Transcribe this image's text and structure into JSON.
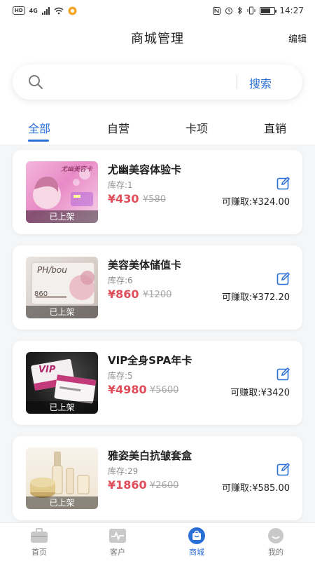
{
  "status_bar": {
    "left_badges": [
      "HD",
      "4G"
    ],
    "time": "14:27"
  },
  "header": {
    "title": "商城管理",
    "edit_label": "编辑"
  },
  "search": {
    "placeholder": "",
    "button_label": "搜索"
  },
  "tabs": [
    {
      "label": "全部",
      "active": true
    },
    {
      "label": "自营",
      "active": false
    },
    {
      "label": "卡项",
      "active": false
    },
    {
      "label": "直销",
      "active": false
    }
  ],
  "products": [
    {
      "title": "尤幽美容体验卡",
      "stock": "库存:1",
      "price": "¥430",
      "original_price": "¥580",
      "earnings": "可赚取:¥324.00",
      "status": "已上架",
      "thumb_text": "尤幽美容卡",
      "thumb_icon": "beauty-card-pink"
    },
    {
      "title": "美容美体储值卡",
      "stock": "库存:6",
      "price": "¥860",
      "original_price": "¥1200",
      "earnings": "可赚取:¥372.20",
      "status": "已上架",
      "thumb_text": "PH/bou",
      "thumb_text2": "860",
      "thumb_icon": "membership-card"
    },
    {
      "title": "VIP全身SPA年卡",
      "stock": "库存:5",
      "price": "¥4980",
      "original_price": "¥5600",
      "earnings": "可赚取:¥3420",
      "status": "已上架",
      "thumb_text": "VIP",
      "thumb_icon": "vip-card"
    },
    {
      "title": "雅姿美白抗皱套盒",
      "stock": "库存:29",
      "price": "¥1860",
      "original_price": "¥2600",
      "earnings": "可赚取:¥585.00",
      "status": "已上架",
      "thumb_icon": "cosmetics-set"
    }
  ],
  "bottom_nav": [
    {
      "label": "首页",
      "icon": "home-briefcase-icon",
      "active": false
    },
    {
      "label": "客户",
      "icon": "customer-pulse-icon",
      "active": false
    },
    {
      "label": "商城",
      "icon": "shop-bag-icon",
      "active": true
    },
    {
      "label": "我的",
      "icon": "profile-face-icon",
      "active": false
    }
  ],
  "colors": {
    "accent": "#2a6fd6",
    "price": "#e04d5a",
    "background": "#f5f6f8"
  }
}
